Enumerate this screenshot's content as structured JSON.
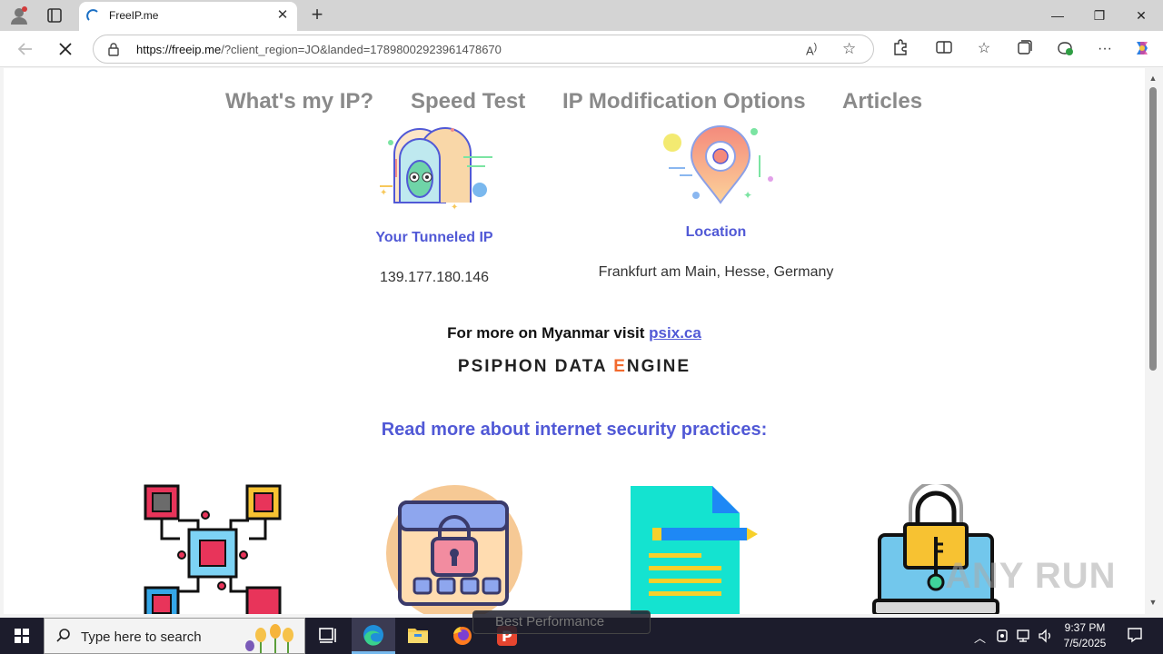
{
  "browser": {
    "tab_title": "FreeIP.me",
    "url_host": "https://freeip.me",
    "url_rest": "/?client_region=JO&landed=17898002923961478670"
  },
  "nav": {
    "items": [
      "What's my IP?",
      "Speed Test",
      "IP Modification Options",
      "Articles"
    ]
  },
  "cards": {
    "tunneled_label": "Your Tunneled IP",
    "tunneled_value": "139.177.180.146",
    "location_label": "Location",
    "location_value": "Frankfurt am Main, Hesse, Germany"
  },
  "myanmar": {
    "text": "For more on Myanmar visit ",
    "link": "psix.ca"
  },
  "psiphon": {
    "pre": "PSIPHON DATA ",
    "e": "E",
    "post": "NGINE"
  },
  "readmore": "Read more about internet security practices:",
  "taskbar": {
    "search_placeholder": "Type here to search",
    "time": "9:37 PM",
    "date": "7/5/2025",
    "overlay_text": "Best Performance"
  },
  "watermark": "ANY RUN",
  "colors": {
    "accent": "#5159d6",
    "menu_gray": "#8a8a8a",
    "psiphon_e": "#f26a2e"
  }
}
